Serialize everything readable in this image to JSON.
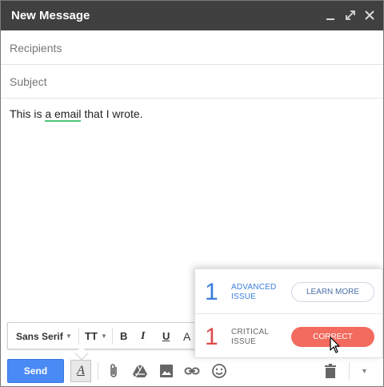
{
  "window": {
    "title": "New Message"
  },
  "compose": {
    "recipients_placeholder": "Recipients",
    "subject_placeholder": "Subject",
    "body": {
      "before": "This is ",
      "flagged": "a email",
      "after": " that I wrote."
    }
  },
  "format_bar": {
    "font": "Sans Serif",
    "size_icon": "TT",
    "bold": "B",
    "italic": "I",
    "underline": "U",
    "text_color": "A"
  },
  "toolbar": {
    "send_label": "Send",
    "format_toggle": "A",
    "icons": [
      "paperclip-icon",
      "drive-icon",
      "photo-icon",
      "link-icon",
      "emoji-icon",
      "trash-icon",
      "more-options-icon"
    ]
  },
  "grammar_popup": {
    "advanced": {
      "count": "1",
      "label_line1": "ADVANCED",
      "label_line2": "ISSUE",
      "button": "LEARN MORE"
    },
    "critical": {
      "count": "1",
      "label_line1": "CRITICAL",
      "label_line2": "ISSUE",
      "button": "CORRECT"
    }
  },
  "colors": {
    "titlebar": "#404040",
    "send_button": "#4a8af4",
    "advanced_blue": "#3b7ddd",
    "critical_red": "#e04b4b",
    "correct_button": "#f26b5e",
    "flag_underline": "#4cc57a"
  }
}
